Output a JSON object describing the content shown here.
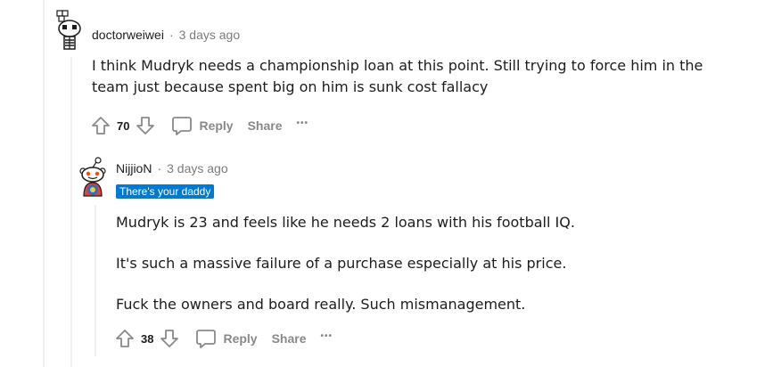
{
  "comments": [
    {
      "username": "doctorweiwei",
      "separator": "·",
      "time": "3 days ago",
      "paragraphs": [
        "I think Mudryk needs a championship loan at this point. Still trying to force him in the team just because spent big on him is sunk cost fallacy"
      ],
      "votes": "70",
      "reply_label": "Reply",
      "share_label": "Share",
      "more_label": "•••"
    },
    {
      "username": "NijjioN",
      "separator": "·",
      "time": "3 days ago",
      "flair": "There's your daddy",
      "paragraphs": [
        "Mudryk is 23 and feels like he needs 2 loans with his football IQ.",
        "It's such a massive failure of a purchase especially at his price.",
        "Fuck the owners and board really. Such mismanagement."
      ],
      "votes": "38",
      "reply_label": "Reply",
      "share_label": "Share",
      "more_label": "•••"
    }
  ],
  "colors": {
    "flair_bg": "#0079d3",
    "meta_gray": "#7c7c7c",
    "action_gray": "#878a8c",
    "thread_line": "#edeff1"
  }
}
